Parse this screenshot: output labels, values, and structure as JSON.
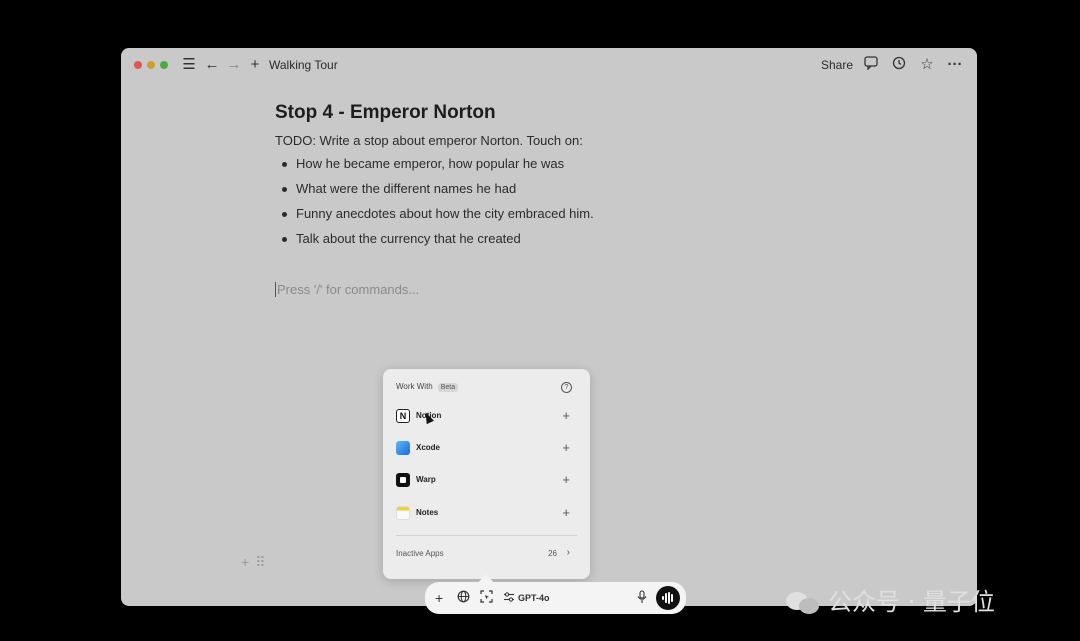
{
  "window": {
    "title": "Walking Tour",
    "toolbar": {
      "share_label": "Share"
    }
  },
  "document": {
    "title": "Stop 4 - Emperor Norton",
    "todo": "TODO: Write a stop about emperor Norton. Touch on:",
    "bullets": [
      "How he became emperor, how popular he was",
      "What were the different names he had",
      "Funny anecdotes about how the city embraced him.",
      "Talk about the currency that he created"
    ],
    "placeholder": "Press '/' for commands..."
  },
  "work_with": {
    "title": "Work With",
    "badge": "Beta",
    "apps": [
      {
        "name": "Notion",
        "icon": "notion-icon"
      },
      {
        "name": "Xcode",
        "icon": "xcode-icon"
      },
      {
        "name": "Warp",
        "icon": "warp-icon"
      },
      {
        "name": "Notes",
        "icon": "notes-icon"
      }
    ],
    "inactive_label": "Inactive Apps",
    "inactive_count": "26"
  },
  "composer": {
    "model": "GPT-4o"
  },
  "watermark": {
    "text": "公众号 · 量子位"
  },
  "colors": {
    "background": "#000000",
    "window": "#c9c9c9",
    "popup": "#ececec"
  }
}
